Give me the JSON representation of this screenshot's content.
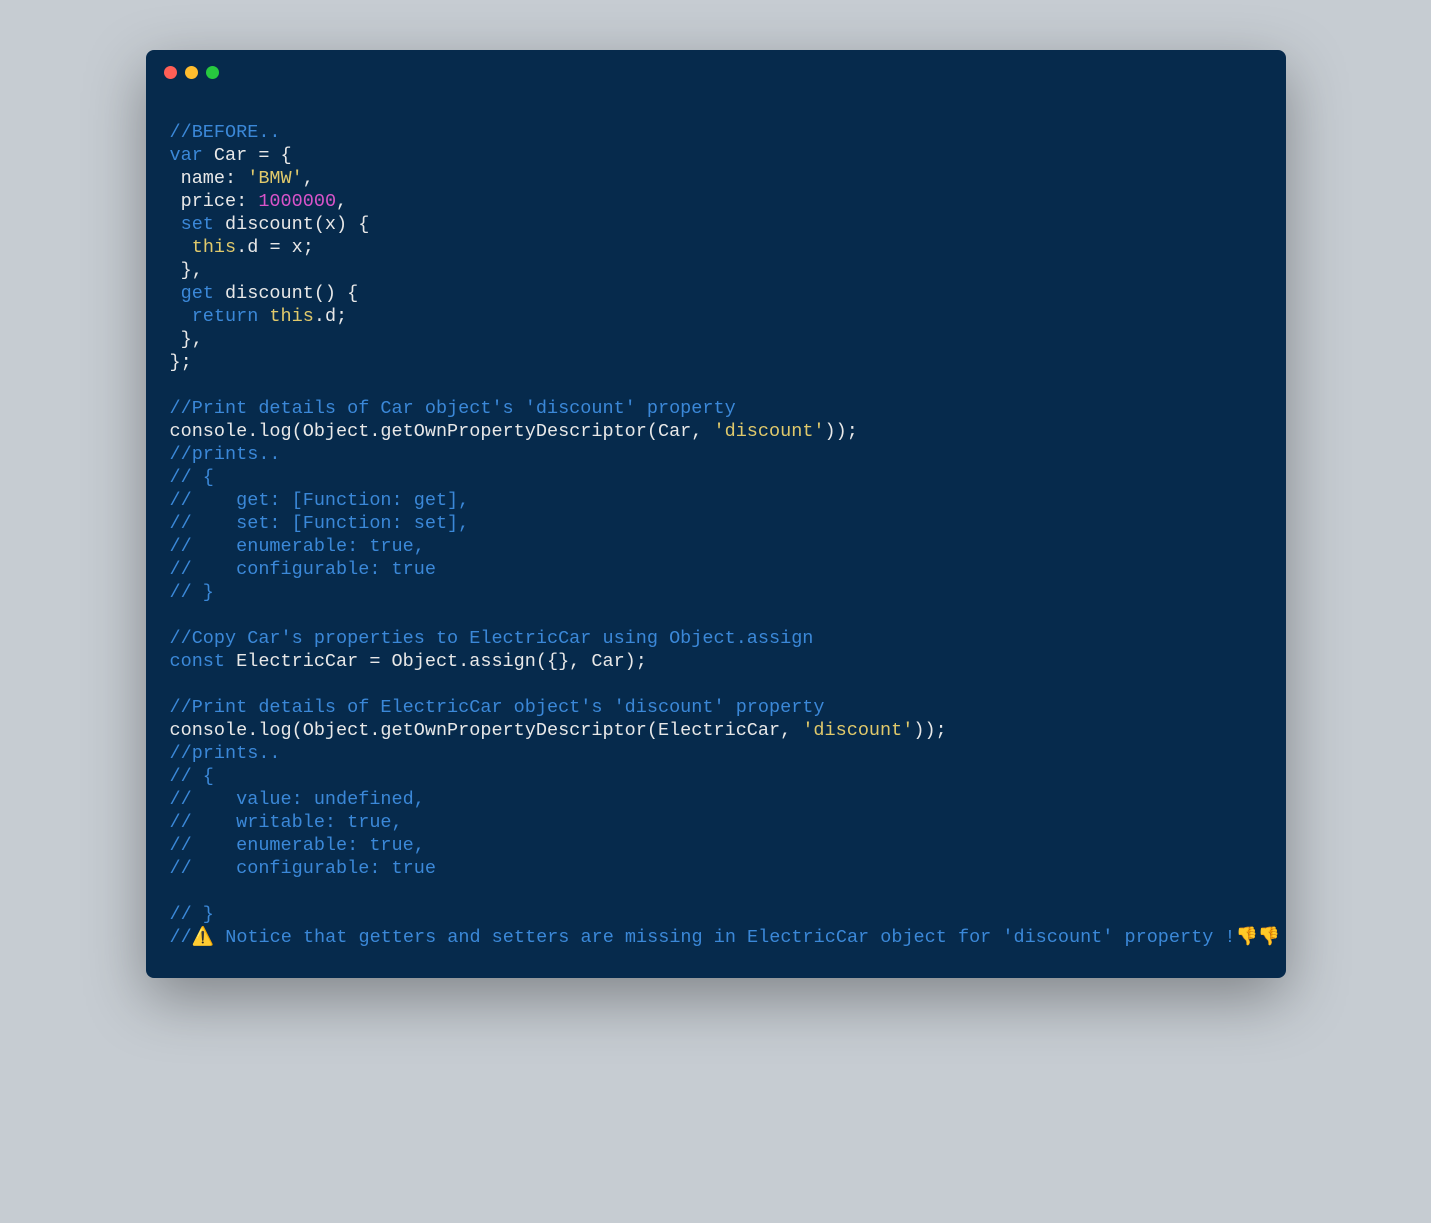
{
  "code": {
    "l1": "//BEFORE..",
    "l2a": "var",
    "l2b": " Car = {",
    "l3a": " name: ",
    "l3b": "'BMW'",
    "l3c": ",",
    "l4a": " price: ",
    "l4b": "1000000",
    "l4c": ",",
    "l5a": " set ",
    "l5b": "discount(x) {",
    "l6a": "  ",
    "l6b": "this",
    "l6c": ".d = x;",
    "l7": " },",
    "l8a": " get ",
    "l8b": "discount() {",
    "l9a": "  return ",
    "l9b": "this",
    "l9c": ".d;",
    "l10": " },",
    "l11": "};",
    "l12": "",
    "l13": "//Print details of Car object's 'discount' property",
    "l14a": "console.log(Object.getOwnPropertyDescriptor(Car, ",
    "l14b": "'discount'",
    "l14c": "));",
    "l15": "//prints..",
    "l16": "// {",
    "l17": "//    get: [Function: get],",
    "l18": "//    set: [Function: set],",
    "l19": "//    enumerable: true,",
    "l20": "//    configurable: true",
    "l21": "// }",
    "l22": "",
    "l23": "//Copy Car's properties to ElectricCar using Object.assign",
    "l24a": "const",
    "l24b": " ElectricCar = Object.assign({}, Car);",
    "l25": "",
    "l26": "//Print details of ElectricCar object's 'discount' property",
    "l27a": "console.log(Object.getOwnPropertyDescriptor(ElectricCar, ",
    "l27b": "'discount'",
    "l27c": "));",
    "l28": "//prints..",
    "l29": "// {",
    "l30": "//    value: undefined,",
    "l31": "//    writable: true,",
    "l32": "//    enumerable: true,",
    "l33": "//    configurable: true",
    "l34": "",
    "l35": "// }",
    "l36a": "//",
    "l36b": "⚠️",
    "l36c": " Notice that getters and setters are missing in ElectricCar object for 'discount' property !",
    "l36d": "👎👎"
  }
}
